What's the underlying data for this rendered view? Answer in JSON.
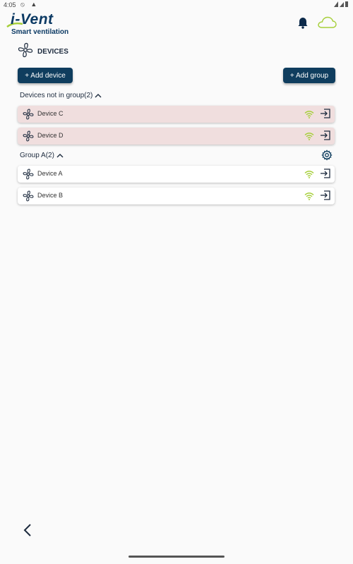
{
  "status_bar": {
    "time": "4:05"
  },
  "header": {
    "logo_text": "i-Vent",
    "tagline": "Smart ventilation"
  },
  "page": {
    "title": "DEVICES"
  },
  "actions": {
    "add_device": "+ Add device",
    "add_group": "+ Add group"
  },
  "ungrouped": {
    "title": "Devices not in group(2)",
    "devices": [
      {
        "name": "Device C"
      },
      {
        "name": "Device D"
      }
    ]
  },
  "groups": [
    {
      "title": "Group A(2)",
      "devices": [
        {
          "name": "Device A"
        },
        {
          "name": "Device B"
        }
      ]
    }
  ],
  "colors": {
    "primary": "#0f3d5e",
    "ungrouped_bg": "#f0dede",
    "wifi": "#a6cf3a",
    "cloud": "#a6cf3a"
  }
}
